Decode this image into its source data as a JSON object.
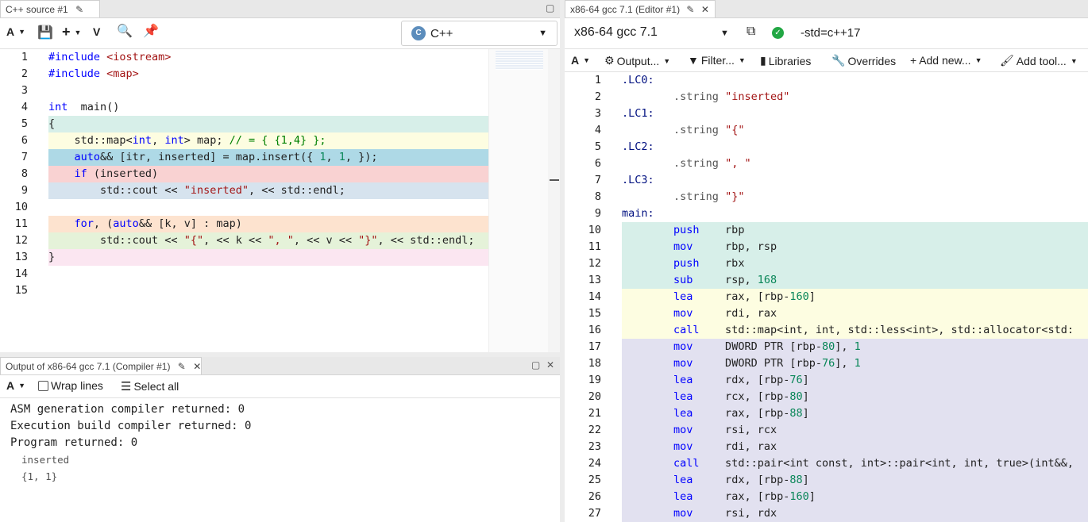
{
  "source_pane": {
    "tab_title": "C++ source #1",
    "language": "C++",
    "lines": [
      {
        "n": "1",
        "bg": "#ffffff",
        "html": [
          [
            "inc",
            "#include "
          ],
          [
            "str",
            "<iostream>"
          ]
        ]
      },
      {
        "n": "2",
        "bg": "#ffffff",
        "html": [
          [
            "inc",
            "#include "
          ],
          [
            "str",
            "<map>"
          ]
        ]
      },
      {
        "n": "3",
        "bg": "#ffffff",
        "html": []
      },
      {
        "n": "4",
        "bg": "#ffffff",
        "html": [
          [
            "kw",
            "int"
          ],
          [
            "",
            "  main()"
          ]
        ]
      },
      {
        "n": "5",
        "bg": "#d7efe9",
        "html": [
          [
            "",
            "{"
          ]
        ]
      },
      {
        "n": "6",
        "bg": "#fdfde1",
        "html": [
          [
            "",
            "    std::map<"
          ],
          [
            "kw",
            "int"
          ],
          [
            "",
            ", "
          ],
          [
            "kw",
            "int"
          ],
          [
            "",
            "> map; "
          ],
          [
            "cm",
            "// = { {1,4} };"
          ]
        ]
      },
      {
        "n": "7",
        "bg": "#aed9e6",
        "html": [
          [
            "",
            "    "
          ],
          [
            "kw",
            "auto"
          ],
          [
            "",
            "&& [itr, inserted] = map.insert({ "
          ],
          [
            "num",
            "1"
          ],
          [
            "",
            ", "
          ],
          [
            "num",
            "1"
          ],
          [
            "",
            ", });"
          ]
        ]
      },
      {
        "n": "8",
        "bg": "#f9d2d2",
        "html": [
          [
            "",
            "    "
          ],
          [
            "kw",
            "if"
          ],
          [
            "",
            " (inserted)"
          ]
        ]
      },
      {
        "n": "9",
        "bg": "#d6e3ee",
        "html": [
          [
            "",
            "        std::cout << "
          ],
          [
            "str",
            "\"inserted\""
          ],
          [
            "",
            ", << std::endl;"
          ]
        ]
      },
      {
        "n": "10",
        "bg": "#ffffff",
        "html": []
      },
      {
        "n": "11",
        "bg": "#fde3cf",
        "html": [
          [
            "",
            "    "
          ],
          [
            "kw",
            "for"
          ],
          [
            "",
            ", ("
          ],
          [
            "kw",
            "auto"
          ],
          [
            "",
            "&& [k, v] : map)"
          ]
        ]
      },
      {
        "n": "12",
        "bg": "#e5f2d9",
        "html": [
          [
            "",
            "        std::cout << "
          ],
          [
            "str",
            "\"{\""
          ],
          [
            "",
            ", << k << "
          ],
          [
            "str",
            "\", \""
          ],
          [
            "",
            ", << v << "
          ],
          [
            "str",
            "\"}\""
          ],
          [
            "",
            ", << std::endl;"
          ]
        ]
      },
      {
        "n": "13",
        "bg": "#fbe6f1",
        "html": [
          [
            "",
            "}"
          ]
        ]
      },
      {
        "n": "14",
        "bg": "#ffffff",
        "html": []
      },
      {
        "n": "15",
        "bg": "#ffffff",
        "html": []
      }
    ]
  },
  "output_pane": {
    "tab_title": "Output of x86-64 gcc 7.1 (Compiler #1)",
    "wrap_label": "Wrap lines",
    "select_all_label": "Select all",
    "lines": [
      "ASM generation compiler returned: 0",
      "Execution build compiler returned: 0",
      "Program returned: 0"
    ],
    "stdout": [
      "inserted",
      "{1, 1}"
    ]
  },
  "asm_pane": {
    "tab_title": "x86-64 gcc 7.1 (Editor #1)",
    "compiler": "x86-64 gcc 7.1",
    "flags": "-std=c++17",
    "toolbar": {
      "output": "Output...",
      "filter": "Filter...",
      "libraries": "Libraries",
      "overrides": "Overrides",
      "add_new": "Add new...",
      "add_tool": "Add tool..."
    },
    "lines": [
      {
        "n": "1",
        "bg": "#ffffff",
        "t": [
          [
            "asm-label",
            ".LC0:"
          ]
        ]
      },
      {
        "n": "2",
        "bg": "#ffffff",
        "t": [
          [
            "",
            "        "
          ],
          [
            "asm-key",
            ".string"
          ],
          [
            "asm-str",
            " \"inserted\""
          ]
        ]
      },
      {
        "n": "3",
        "bg": "#ffffff",
        "t": [
          [
            "asm-label",
            ".LC1:"
          ]
        ]
      },
      {
        "n": "4",
        "bg": "#ffffff",
        "t": [
          [
            "",
            "        "
          ],
          [
            "asm-key",
            ".string"
          ],
          [
            "asm-str",
            " \"{\""
          ]
        ]
      },
      {
        "n": "5",
        "bg": "#ffffff",
        "t": [
          [
            "asm-label",
            ".LC2:"
          ]
        ]
      },
      {
        "n": "6",
        "bg": "#ffffff",
        "t": [
          [
            "",
            "        "
          ],
          [
            "asm-key",
            ".string"
          ],
          [
            "asm-str",
            " \", \""
          ]
        ]
      },
      {
        "n": "7",
        "bg": "#ffffff",
        "t": [
          [
            "asm-label",
            ".LC3:"
          ]
        ]
      },
      {
        "n": "8",
        "bg": "#ffffff",
        "t": [
          [
            "",
            "        "
          ],
          [
            "asm-key",
            ".string"
          ],
          [
            "asm-str",
            " \"}\""
          ]
        ]
      },
      {
        "n": "9",
        "bg": "#ffffff",
        "t": [
          [
            "asm-label",
            "main:"
          ]
        ]
      },
      {
        "n": "10",
        "bg": "#d7efe9",
        "t": [
          [
            "",
            "        "
          ],
          [
            "asm-op",
            "push"
          ],
          [
            "",
            "    rbp"
          ]
        ]
      },
      {
        "n": "11",
        "bg": "#d7efe9",
        "t": [
          [
            "",
            "        "
          ],
          [
            "asm-op",
            "mov"
          ],
          [
            "",
            "     rbp, rsp"
          ]
        ]
      },
      {
        "n": "12",
        "bg": "#d7efe9",
        "t": [
          [
            "",
            "        "
          ],
          [
            "asm-op",
            "push"
          ],
          [
            "",
            "    rbx"
          ]
        ]
      },
      {
        "n": "13",
        "bg": "#d7efe9",
        "t": [
          [
            "",
            "        "
          ],
          [
            "asm-op",
            "sub"
          ],
          [
            "",
            "     rsp, "
          ],
          [
            "asm-num",
            "168"
          ]
        ]
      },
      {
        "n": "14",
        "bg": "#fdfde1",
        "t": [
          [
            "",
            "        "
          ],
          [
            "asm-op",
            "lea"
          ],
          [
            "",
            "     rax, [rbp-"
          ],
          [
            "asm-num",
            "160"
          ],
          [
            "",
            "]"
          ]
        ]
      },
      {
        "n": "15",
        "bg": "#fdfde1",
        "t": [
          [
            "",
            "        "
          ],
          [
            "asm-op",
            "mov"
          ],
          [
            "",
            "     rdi, rax"
          ]
        ]
      },
      {
        "n": "16",
        "bg": "#fdfde1",
        "t": [
          [
            "",
            "        "
          ],
          [
            "asm-op",
            "call"
          ],
          [
            "",
            "    std::map<int, int, std::less<int>, std::allocator<std:"
          ]
        ]
      },
      {
        "n": "17",
        "bg": "#e2e1f0",
        "t": [
          [
            "",
            "        "
          ],
          [
            "asm-op",
            "mov"
          ],
          [
            "",
            "     DWORD PTR [rbp-"
          ],
          [
            "asm-num",
            "80"
          ],
          [
            "",
            "], "
          ],
          [
            "asm-num",
            "1"
          ]
        ]
      },
      {
        "n": "18",
        "bg": "#e2e1f0",
        "t": [
          [
            "",
            "        "
          ],
          [
            "asm-op",
            "mov"
          ],
          [
            "",
            "     DWORD PTR [rbp-"
          ],
          [
            "asm-num",
            "76"
          ],
          [
            "",
            "], "
          ],
          [
            "asm-num",
            "1"
          ]
        ]
      },
      {
        "n": "19",
        "bg": "#e2e1f0",
        "t": [
          [
            "",
            "        "
          ],
          [
            "asm-op",
            "lea"
          ],
          [
            "",
            "     rdx, [rbp-"
          ],
          [
            "asm-num",
            "76"
          ],
          [
            "",
            "]"
          ]
        ]
      },
      {
        "n": "20",
        "bg": "#e2e1f0",
        "t": [
          [
            "",
            "        "
          ],
          [
            "asm-op",
            "lea"
          ],
          [
            "",
            "     rcx, [rbp-"
          ],
          [
            "asm-num",
            "80"
          ],
          [
            "",
            "]"
          ]
        ]
      },
      {
        "n": "21",
        "bg": "#e2e1f0",
        "t": [
          [
            "",
            "        "
          ],
          [
            "asm-op",
            "lea"
          ],
          [
            "",
            "     rax, [rbp-"
          ],
          [
            "asm-num",
            "88"
          ],
          [
            "",
            "]"
          ]
        ]
      },
      {
        "n": "22",
        "bg": "#e2e1f0",
        "t": [
          [
            "",
            "        "
          ],
          [
            "asm-op",
            "mov"
          ],
          [
            "",
            "     rsi, rcx"
          ]
        ]
      },
      {
        "n": "23",
        "bg": "#e2e1f0",
        "t": [
          [
            "",
            "        "
          ],
          [
            "asm-op",
            "mov"
          ],
          [
            "",
            "     rdi, rax"
          ]
        ]
      },
      {
        "n": "24",
        "bg": "#e2e1f0",
        "t": [
          [
            "",
            "        "
          ],
          [
            "asm-op",
            "call"
          ],
          [
            "",
            "    std::pair<int const, int>::pair<int, int, true>(int&&,"
          ]
        ]
      },
      {
        "n": "25",
        "bg": "#e2e1f0",
        "t": [
          [
            "",
            "        "
          ],
          [
            "asm-op",
            "lea"
          ],
          [
            "",
            "     rdx, [rbp-"
          ],
          [
            "asm-num",
            "88"
          ],
          [
            "",
            "]"
          ]
        ]
      },
      {
        "n": "26",
        "bg": "#e2e1f0",
        "t": [
          [
            "",
            "        "
          ],
          [
            "asm-op",
            "lea"
          ],
          [
            "",
            "     rax, [rbp-"
          ],
          [
            "asm-num",
            "160"
          ],
          [
            "",
            "]"
          ]
        ]
      },
      {
        "n": "27",
        "bg": "#e2e1f0",
        "t": [
          [
            "",
            "        "
          ],
          [
            "asm-op",
            "mov"
          ],
          [
            "",
            "     rsi, rdx"
          ]
        ]
      }
    ]
  }
}
